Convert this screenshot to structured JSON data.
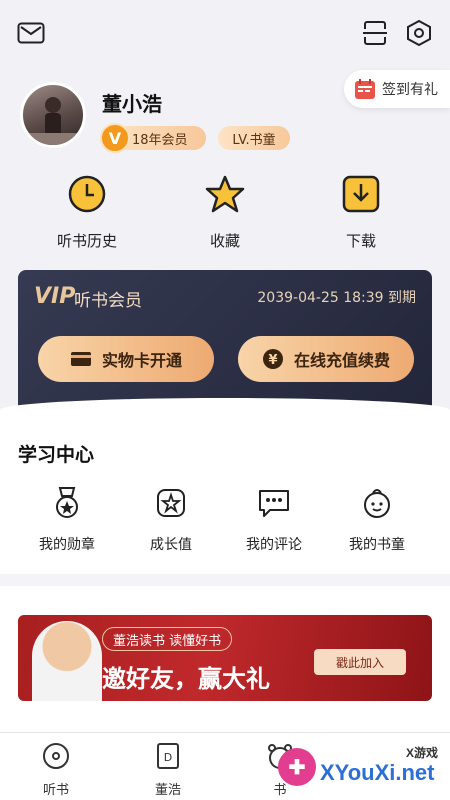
{
  "header": {
    "signin_label": "签到有礼"
  },
  "profile": {
    "name": "董小浩",
    "member_badge": "18年会员",
    "member_badge_icon": "V",
    "level_badge": "LV.书童"
  },
  "quick_actions": [
    {
      "label": "听书历史",
      "icon": "clock-icon"
    },
    {
      "label": "收藏",
      "icon": "star-icon"
    },
    {
      "label": "下载",
      "icon": "download-icon"
    }
  ],
  "vip": {
    "logo": "VIP",
    "title": "听书会员",
    "expiry": "2039-04-25 18:39 到期",
    "buttons": [
      {
        "label": "实物卡开通",
        "icon": "card-icon"
      },
      {
        "label": "在线充值续费",
        "icon": "yen-icon"
      }
    ]
  },
  "learning": {
    "title": "学习中心",
    "items": [
      {
        "label": "我的勋章",
        "icon": "medal-icon"
      },
      {
        "label": "成长值",
        "icon": "growth-icon"
      },
      {
        "label": "我的评论",
        "icon": "comment-icon"
      },
      {
        "label": "我的书童",
        "icon": "baby-face-icon"
      }
    ]
  },
  "banner": {
    "pill": "董浩读书 读懂好书",
    "headline": "邀好友，赢大礼",
    "cta": "戳此加入"
  },
  "tabbar": [
    {
      "label": "听书",
      "icon": "disc-icon"
    },
    {
      "label": "董浩",
      "icon": "book-d-icon"
    },
    {
      "label": "书",
      "icon": "bear-icon"
    }
  ],
  "watermark": {
    "main": "XYouXi.net",
    "small": "X游戏",
    "logo": "✚"
  },
  "colors": {
    "accent_gold": "#eeaa72",
    "vip_bg": "#2a2d42",
    "banner_red": "#b82426",
    "icon_yellow": "#f7c23a"
  }
}
